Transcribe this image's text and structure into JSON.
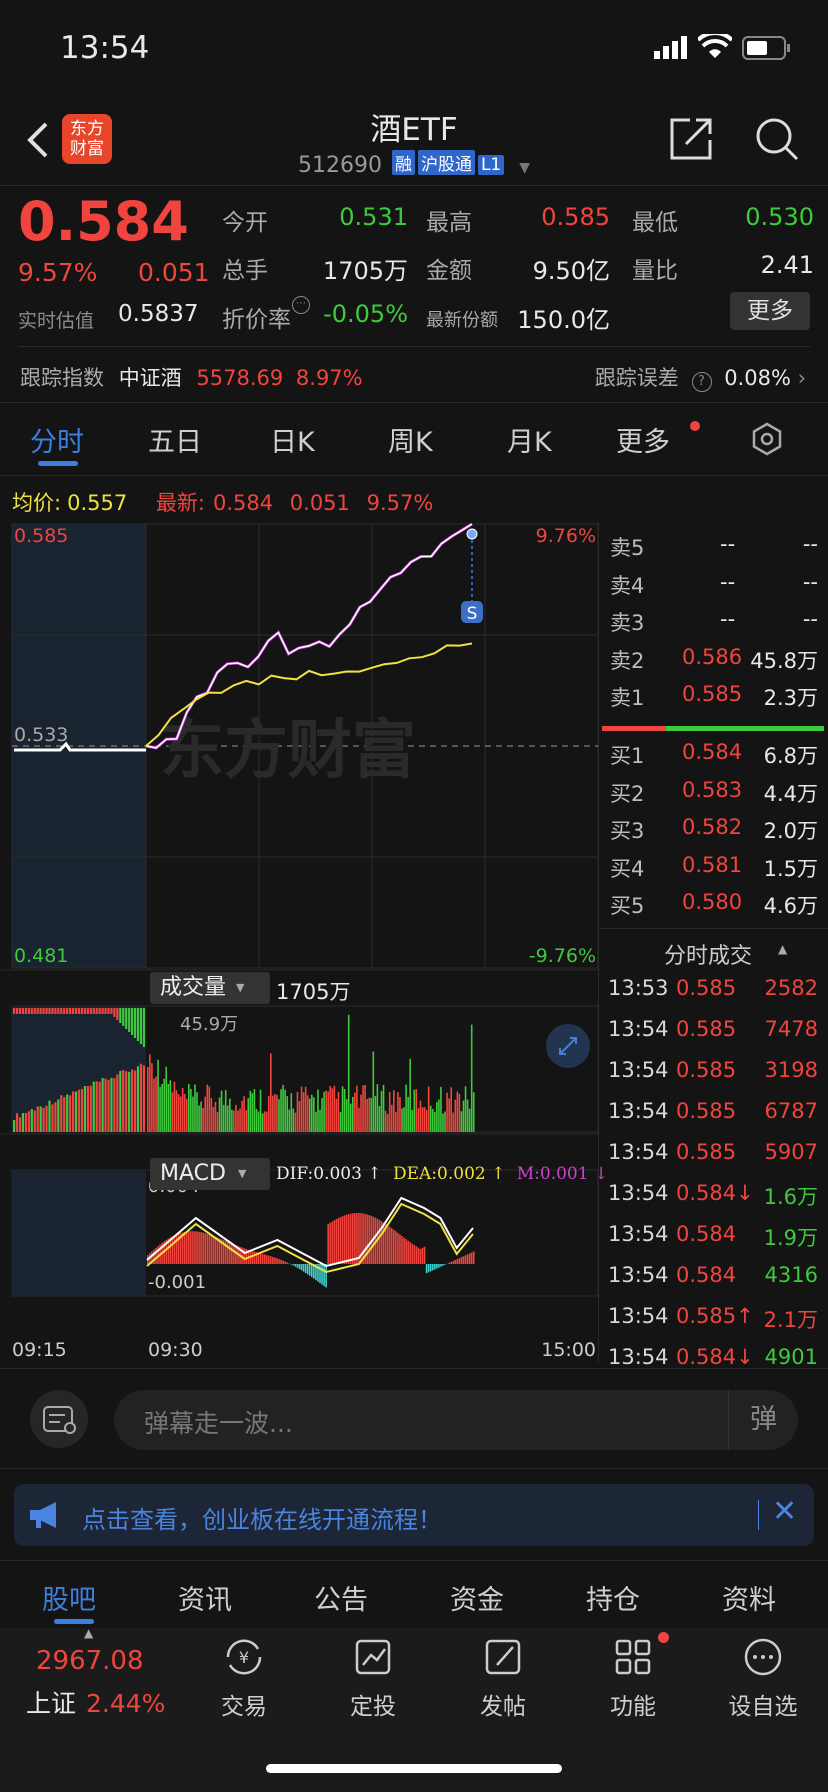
{
  "status_bar": {
    "time": "13:54"
  },
  "header": {
    "title": "酒ETF",
    "code": "512690",
    "badges": [
      "融",
      "沪股通",
      "L1"
    ],
    "logo_text": "东方财富"
  },
  "quote": {
    "price": "0.584",
    "change_pct": "9.57%",
    "change": "0.051",
    "est_label": "实时估值",
    "est_value": "0.5837",
    "open_label": "今开",
    "open": "0.531",
    "high_label": "最高",
    "high": "0.585",
    "low_label": "最低",
    "low": "0.530",
    "vol_label": "总手",
    "vol": "1705万",
    "amt_label": "金额",
    "amt": "9.50亿",
    "ratio_label": "量比",
    "ratio": "2.41",
    "disc_label": "折价率",
    "disc": "-0.05%",
    "share_label": "最新份额",
    "share": "150.0亿",
    "more_button": "更多"
  },
  "track": {
    "label": "跟踪指数",
    "index_name": "中证酒",
    "index_value": "5578.69",
    "index_change": "8.97%",
    "err_label": "跟踪误差",
    "err_value": "0.08%"
  },
  "tabs": [
    "分时",
    "五日",
    "日K",
    "周K",
    "月K",
    "更多"
  ],
  "chart_header": {
    "avg_label": "均价:",
    "avg_value": "0.557",
    "latest_label": "最新:",
    "latest_price": "0.584",
    "latest_change": "0.051",
    "latest_pct": "9.57%"
  },
  "chart_data": {
    "type": "line",
    "y_top": "0.585",
    "y_mid": "0.533",
    "y_bottom": "0.481",
    "pct_top": "9.76%",
    "pct_bottom": "-9.76%",
    "x_labels": [
      "09:15",
      "09:30",
      "15:00"
    ],
    "signal_marker": "S",
    "watermark": "东方财富",
    "ylim": [
      0.481,
      0.585
    ],
    "price": [
      0.533,
      0.533,
      0.534,
      0.535,
      0.541,
      0.544,
      0.546,
      0.55,
      0.552,
      0.553,
      0.551,
      0.554,
      0.558,
      0.559,
      0.555,
      0.556,
      0.556,
      0.558,
      0.556,
      0.559,
      0.562,
      0.565,
      0.567,
      0.57,
      0.572,
      0.574,
      0.576,
      0.577,
      0.578,
      0.58,
      0.582,
      0.584,
      0.585
    ],
    "avg": [
      0.533,
      0.536,
      0.539,
      0.542,
      0.544,
      0.545,
      0.546,
      0.547,
      0.548,
      0.548,
      0.549,
      0.549,
      0.549,
      0.55,
      0.55,
      0.55,
      0.55,
      0.551,
      0.551,
      0.552,
      0.553,
      0.553,
      0.554,
      0.555,
      0.556,
      0.557,
      0.557
    ]
  },
  "volume": {
    "label": "成交量",
    "total": "1705万",
    "max_label": "45.9万"
  },
  "macd": {
    "label": "MACD",
    "dif": "DIF:0.003 ↑",
    "dea": "DEA:0.002 ↑",
    "m": "M:0.001 ↓",
    "top": "0.004",
    "bottom": "-0.001"
  },
  "order_book": {
    "asks": [
      {
        "label": "卖5",
        "price": "--",
        "vol": "--"
      },
      {
        "label": "卖4",
        "price": "--",
        "vol": "--"
      },
      {
        "label": "卖3",
        "price": "--",
        "vol": "--"
      },
      {
        "label": "卖2",
        "price": "0.586",
        "vol": "45.8万"
      },
      {
        "label": "卖1",
        "price": "0.585",
        "vol": "2.3万"
      }
    ],
    "bids": [
      {
        "label": "买1",
        "price": "0.584",
        "vol": "6.8万"
      },
      {
        "label": "买2",
        "price": "0.583",
        "vol": "4.4万"
      },
      {
        "label": "买3",
        "price": "0.582",
        "vol": "2.0万"
      },
      {
        "label": "买4",
        "price": "0.581",
        "vol": "1.5万"
      },
      {
        "label": "买5",
        "price": "0.580",
        "vol": "4.6万"
      }
    ]
  },
  "trades": {
    "title": "分时成交",
    "rows": [
      {
        "t": "13:53",
        "p": "0.585",
        "v": "2582",
        "c": "red"
      },
      {
        "t": "13:54",
        "p": "0.585",
        "v": "7478",
        "c": "red"
      },
      {
        "t": "13:54",
        "p": "0.585",
        "v": "3198",
        "c": "red"
      },
      {
        "t": "13:54",
        "p": "0.585",
        "v": "6787",
        "c": "red"
      },
      {
        "t": "13:54",
        "p": "0.585",
        "v": "5907",
        "c": "red"
      },
      {
        "t": "13:54",
        "p": "0.584↓",
        "v": "1.6万",
        "c": "green"
      },
      {
        "t": "13:54",
        "p": "0.584",
        "v": "1.9万",
        "c": "green"
      },
      {
        "t": "13:54",
        "p": "0.584",
        "v": "4316",
        "c": "green"
      },
      {
        "t": "13:54",
        "p": "0.585↑",
        "v": "2.1万",
        "c": "red"
      },
      {
        "t": "13:54",
        "p": "0.584↓",
        "v": "4901",
        "c": "green"
      }
    ]
  },
  "comment": {
    "placeholder": "弹幕走一波...",
    "btn": "弹"
  },
  "banner": {
    "text": "点击查看，创业板在线开通流程！"
  },
  "bottom_tabs": [
    "股吧",
    "资讯",
    "公告",
    "资金",
    "持仓",
    "资料"
  ],
  "nav": {
    "index_value": "2967.08",
    "index_name": "上证",
    "index_pct": "2.44%",
    "items": [
      "交易",
      "定投",
      "发帖",
      "功能",
      "设自选"
    ]
  },
  "colors": {
    "up": "#f0453e",
    "down": "#3fc93d",
    "accent": "#3d7fe0",
    "avg_line": "#f0e040"
  }
}
